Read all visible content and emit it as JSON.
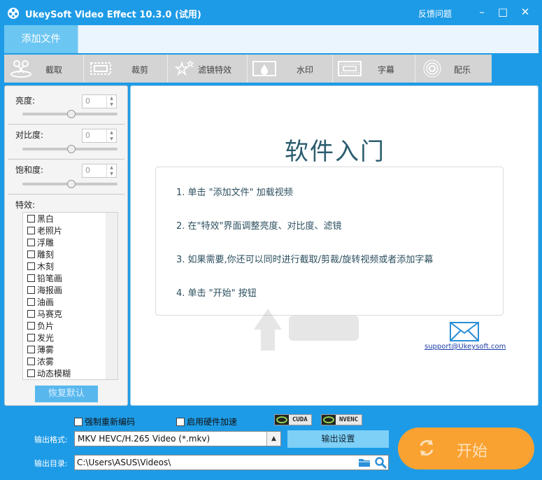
{
  "app": {
    "title": "UkeySoft Video Effect 10.3.0 (试用)",
    "feedback": "反馈问题",
    "controls": {
      "minimize": "–",
      "maximize": "□",
      "close": "✕"
    }
  },
  "tabs": {
    "add_file": "添加文件"
  },
  "toolbar": {
    "items": [
      {
        "label": "截取",
        "icon": "cut-icon"
      },
      {
        "label": "裁剪",
        "icon": "crop-icon"
      },
      {
        "label": "滤镜特效",
        "icon": "filter-icon"
      },
      {
        "label": "水印",
        "icon": "watermark-icon"
      },
      {
        "label": "字幕",
        "icon": "subtitle-icon"
      },
      {
        "label": "配乐",
        "icon": "music-icon"
      }
    ]
  },
  "adjust": {
    "brightness": {
      "label": "亮度:",
      "value": "0"
    },
    "contrast": {
      "label": "对比度:",
      "value": "0"
    },
    "saturation": {
      "label": "饱和度:",
      "value": "0"
    }
  },
  "effects": {
    "label": "特效:",
    "items": [
      "黑白",
      "老照片",
      "浮雕",
      "雕刻",
      "木刻",
      "铅笔画",
      "海报画",
      "油画",
      "马赛克",
      "负片",
      "发光",
      "薄雾",
      "浓雾",
      "动态模糊"
    ],
    "reset": "恢复默认"
  },
  "intro": {
    "title": "软件入门",
    "steps": [
      "1. 单击 \"添加文件\" 加载视频",
      "2. 在\"特效\"界面调整亮度、对比度、滤镜",
      "3. 如果需要,你还可以同时进行截取/剪裁/旋转视频或者添加字幕",
      "4. 单击 \"开始\" 按钮"
    ],
    "support": "support@Ukeysoft.com"
  },
  "bottom": {
    "force_reencode": "强制重新编码",
    "hw_accel": "启用硬件加速",
    "cuda": "CUDA",
    "nvenc": "NVENC",
    "format_label": "输出格式:",
    "format_value": "MKV HEVC/H.265 Video (*.mkv)",
    "settings": "输出设置",
    "dir_label": "输出目录:",
    "dir_value": "C:\\Users\\ASUS\\Videos\\",
    "start": "开始"
  },
  "colors": {
    "accent": "#1e9be6",
    "start": "#f9a232",
    "toolbar": "#d4d4d4"
  }
}
